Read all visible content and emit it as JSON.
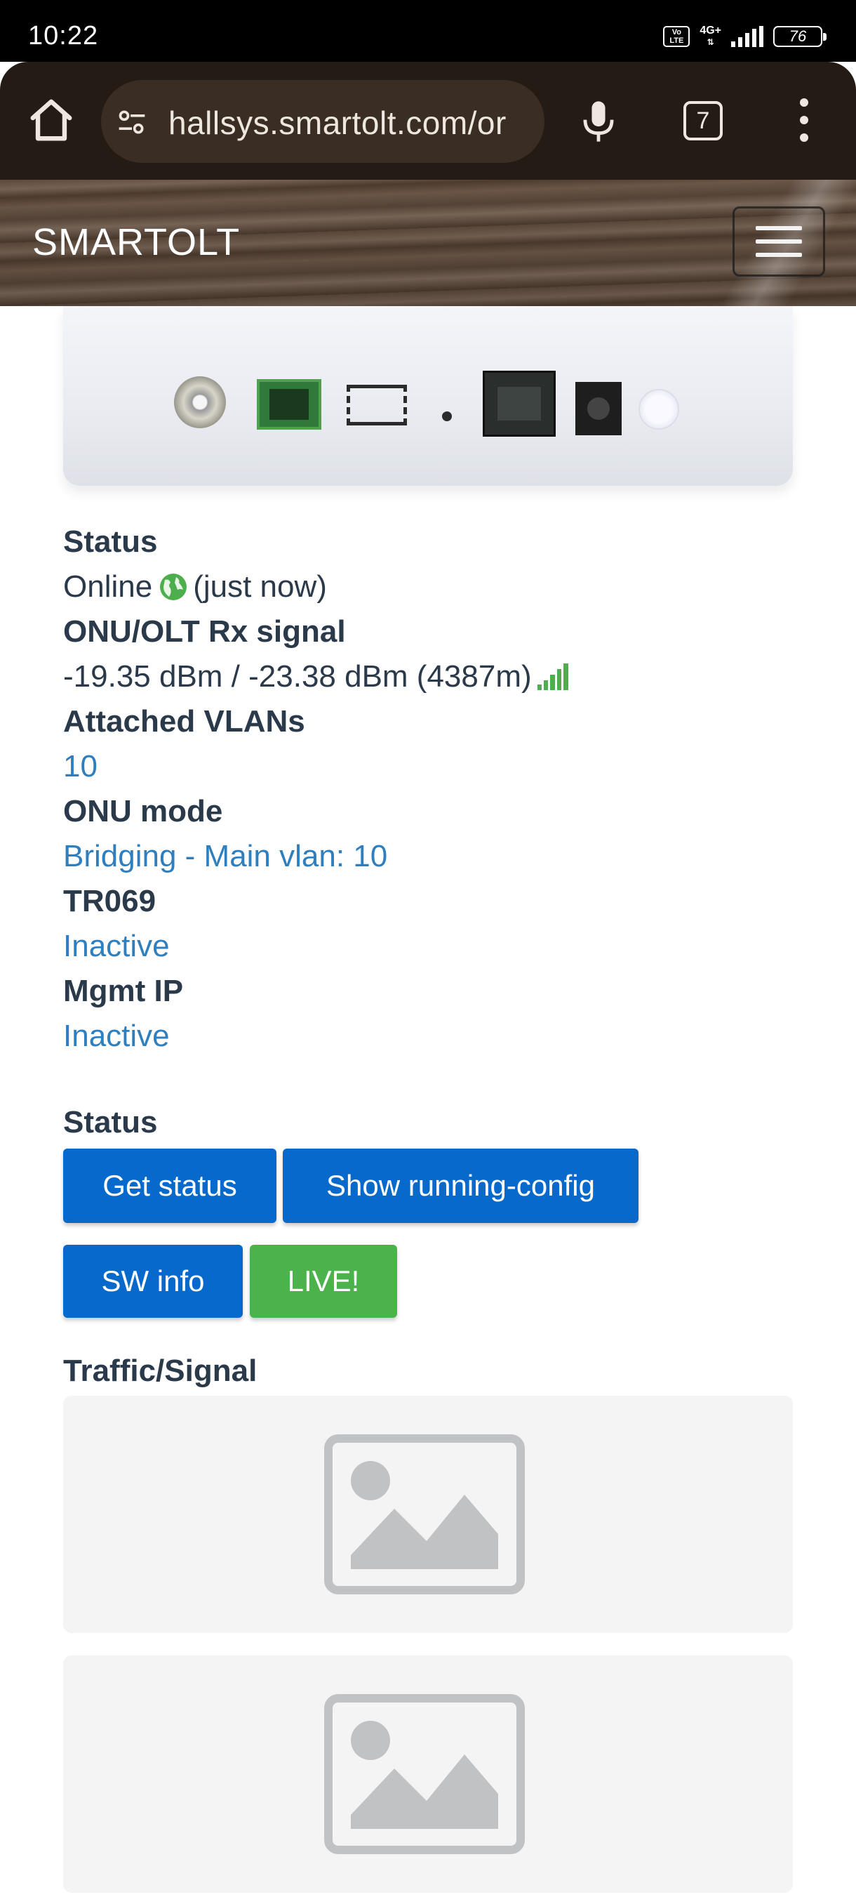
{
  "status_bar": {
    "time": "10:22",
    "volte": "Vo LTE",
    "network": "4G+",
    "battery": "76"
  },
  "browser": {
    "url": "hallsys.smartolt.com/or",
    "tab_count": "7"
  },
  "site": {
    "brand": "SMARTOLT"
  },
  "onu": {
    "status_label": "Status",
    "status_value": "Online",
    "status_time": "(just now)",
    "rx_signal_label": "ONU/OLT Rx signal",
    "rx_signal_value": "-19.35 dBm / -23.38 dBm (4387m)",
    "vlans_label": "Attached VLANs",
    "vlans_value": "10",
    "mode_label": "ONU mode",
    "mode_value": "Bridging - Main vlan: 10",
    "tr069_label": "TR069",
    "tr069_value": "Inactive",
    "mgmt_ip_label": "Mgmt IP",
    "mgmt_ip_value": "Inactive"
  },
  "actions": {
    "section_title": "Status",
    "get_status": "Get status",
    "show_running_config": "Show running-config",
    "sw_info": "SW info",
    "live": "LIVE!"
  },
  "graphs": {
    "section_title": "Traffic/Signal"
  },
  "colors": {
    "primary_button": "#0869cc",
    "live_button": "#4cb24c",
    "link_text": "#2f7fbf",
    "signal_icon": "#4cae4c"
  },
  "icons": [
    "home-icon",
    "tune-icon",
    "mic-icon",
    "more-vert-icon",
    "globe-icon",
    "signal-strength-icon",
    "image-placeholder-icon"
  ]
}
